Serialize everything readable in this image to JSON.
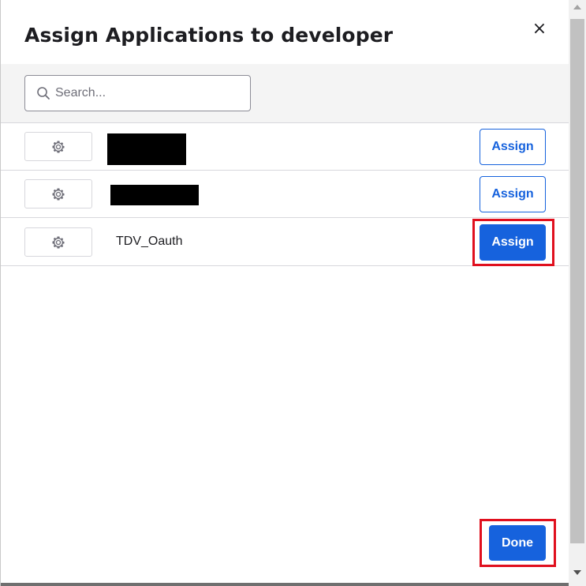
{
  "modal": {
    "title": "Assign Applications to developer",
    "close_label": "×"
  },
  "search": {
    "placeholder": "Search...",
    "value": ""
  },
  "apps": [
    {
      "name": "",
      "assign_label": "Assign",
      "redacted": true
    },
    {
      "name": "",
      "assign_label": "Assign",
      "redacted": true
    },
    {
      "name": "TDV_Oauth",
      "assign_label": "Assign",
      "redacted": false
    }
  ],
  "footer": {
    "done_label": "Done"
  },
  "colors": {
    "primary": "#1662dd",
    "highlight": "#e0101e",
    "divider": "#d7d7dc",
    "search_bar_bg": "#f4f4f4"
  },
  "icons": {
    "settings": "gear-icon",
    "search": "search-icon",
    "close": "close-icon"
  }
}
